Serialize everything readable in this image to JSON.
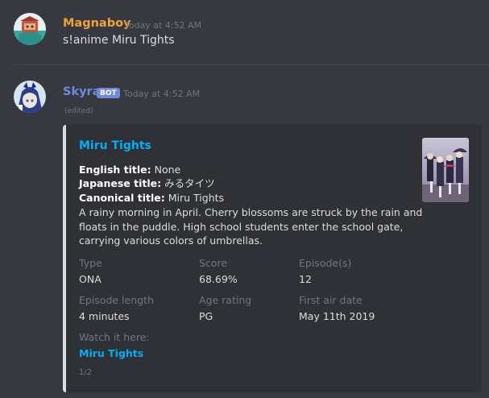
{
  "messages": [
    {
      "username": "Magnaboy",
      "username_color": "#f0a232",
      "timestamp": "Today at 4:52 AM",
      "content": "s!anime Miru Tights"
    },
    {
      "username": "Skyra",
      "username_color": "#7289da",
      "bot_tag": "BOT",
      "timestamp": "Today at 4:52 AM",
      "edited": "(edited)"
    }
  ],
  "embed": {
    "title": "Miru Tights",
    "title_color": "#00b0f4",
    "english_label": "English title:",
    "english_value": "None",
    "japanese_label": "Japanese title:",
    "japanese_value": "みるタイツ",
    "canonical_label": "Canonical title:",
    "canonical_value": "Miru Tights",
    "synopsis_lines": [
      "A rainy morning in April. Cherry blossoms are struck by the rain and",
      "floats in the puddle. High school students enter the school gate,",
      "carrying various colors of umbrellas."
    ],
    "fields": [
      {
        "name": "Type",
        "value": "ONA"
      },
      {
        "name": "Score",
        "value": "68.69%"
      },
      {
        "name": "Episode(s)",
        "value": "12"
      },
      {
        "name": "Episode length",
        "value": "4 minutes"
      },
      {
        "name": "Age rating",
        "value": "PG"
      },
      {
        "name": "First air date",
        "value": "May 11th 2019"
      }
    ],
    "watch_label": "Watch it here:",
    "watch_link": "Miru Tights",
    "footer": "1/2",
    "thumbnail_icon": "anime-cover-thumbnail"
  }
}
